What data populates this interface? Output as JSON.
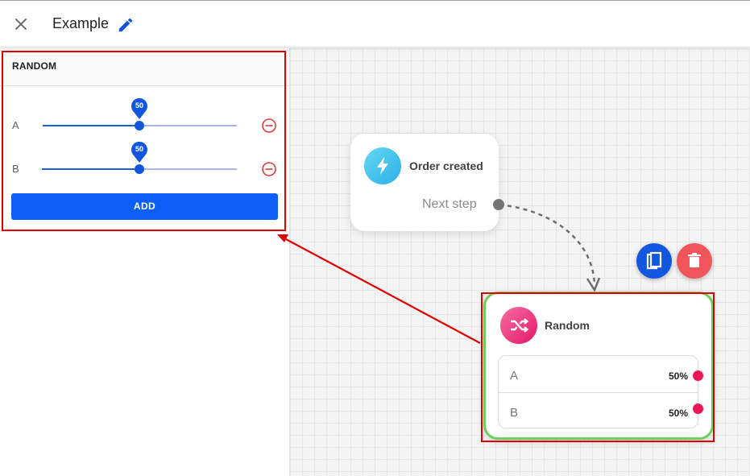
{
  "header": {
    "title": "Example",
    "close_icon": "close-icon",
    "edit_icon": "pencil-icon"
  },
  "panel": {
    "title": "RANDOM",
    "sliders": [
      {
        "label": "A",
        "value": 50,
        "value_text": "50"
      },
      {
        "label": "B",
        "value": 50,
        "value_text": "50"
      }
    ],
    "remove_icon": "minus-circle-icon",
    "add_label": "ADD"
  },
  "canvas": {
    "trigger_node": {
      "title": "Order created",
      "icon": "lightning-icon",
      "next_step": "Next step"
    },
    "random_node": {
      "title": "Random",
      "icon": "shuffle-icon",
      "branches": [
        {
          "name": "A",
          "percent": "50%"
        },
        {
          "name": "B",
          "percent": "50%"
        }
      ]
    },
    "actions": {
      "copy_icon": "copy-icon",
      "delete_icon": "trash-icon"
    }
  },
  "colors": {
    "accent": "#0d5ef5",
    "highlight_border": "#e00000",
    "node_selected": "#6ccf5c",
    "branch_dot": "#ec1654",
    "delete": "#f2545b"
  }
}
